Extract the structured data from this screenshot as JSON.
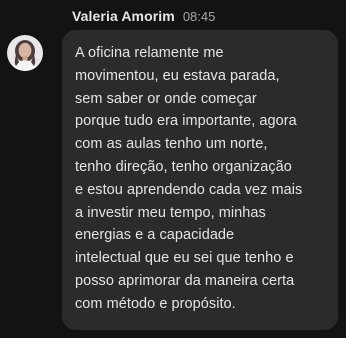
{
  "message": {
    "sender": "Valeria Amorim",
    "time": "08:45",
    "avatar_icon": "person-photo",
    "lines": [
      "A oficina relamente me",
      "movimentou, eu estava parada,",
      "sem saber or onde começar",
      "porque tudo era importante, agora",
      "com as aulas tenho um norte,",
      "tenho direção, tenho organização",
      "e estou aprendendo cada vez mais",
      "a investir meu tempo, minhas",
      "energias e a capacidade",
      "intelectual que eu sei que tenho e",
      "posso aprimorar da maneira certa",
      "com método e propósito."
    ]
  },
  "colors": {
    "background": "#131313",
    "bubble": "#2b2b2b",
    "text": "#e4e4e4",
    "time": "#a6a6a6"
  }
}
